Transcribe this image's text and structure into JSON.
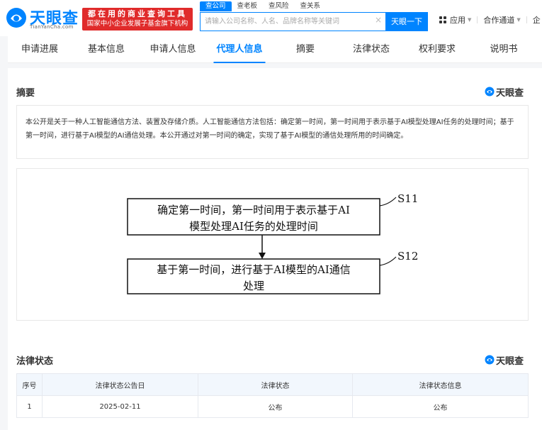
{
  "header": {
    "logo_text": "天眼查",
    "logo_sub": "TianYanCha.com",
    "ad_line1": "都在用的商业查询工具",
    "ad_line2": "国家中小企业发展子基金旗下机构",
    "search_tabs": [
      "查公司",
      "查老板",
      "查风险",
      "查关系"
    ],
    "search_placeholder": "请输入公司名称、人名、品牌名称等关键词",
    "search_button": "天眼一下",
    "apps_label": "应用",
    "cooperation_label": "合作通道",
    "truncated_label": "企"
  },
  "tabs": [
    "申请进展",
    "基本信息",
    "申请人信息",
    "代理人信息",
    "摘要",
    "法律状态",
    "权利要求",
    "说明书"
  ],
  "active_tab": 3,
  "abstract": {
    "title": "摘要",
    "brand": "天眼查",
    "text": "本公开是关于一种人工智能通信方法、装置及存储介质。人工智能通信方法包括：确定第一时间，第一时间用于表示基于AI模型处理AI任务的处理时间；基于第一时间，进行基于AI模型的AI通信处理。本公开通过对第一时间的确定，实现了基于AI模型的通信处理所用的时间确定。"
  },
  "figure": {
    "box1_line1": "确定第一时间，第一时间用于表示基于AI",
    "box1_line2": "模型处理AI任务的处理时间",
    "box2_line1": "基于第一时间，进行基于AI模型的AI通信",
    "box2_line2": "处理",
    "label1": "S11",
    "label2": "S12"
  },
  "legal": {
    "title": "法律状态",
    "brand": "天眼查",
    "columns": [
      "序号",
      "法律状态公告日",
      "法律状态",
      "法律状态信息"
    ],
    "rows": [
      [
        "1",
        "2025-02-11",
        "公布",
        "公布"
      ]
    ]
  },
  "colors": {
    "brand_blue": "#0084ff",
    "ad_red": "#e02b2b"
  }
}
